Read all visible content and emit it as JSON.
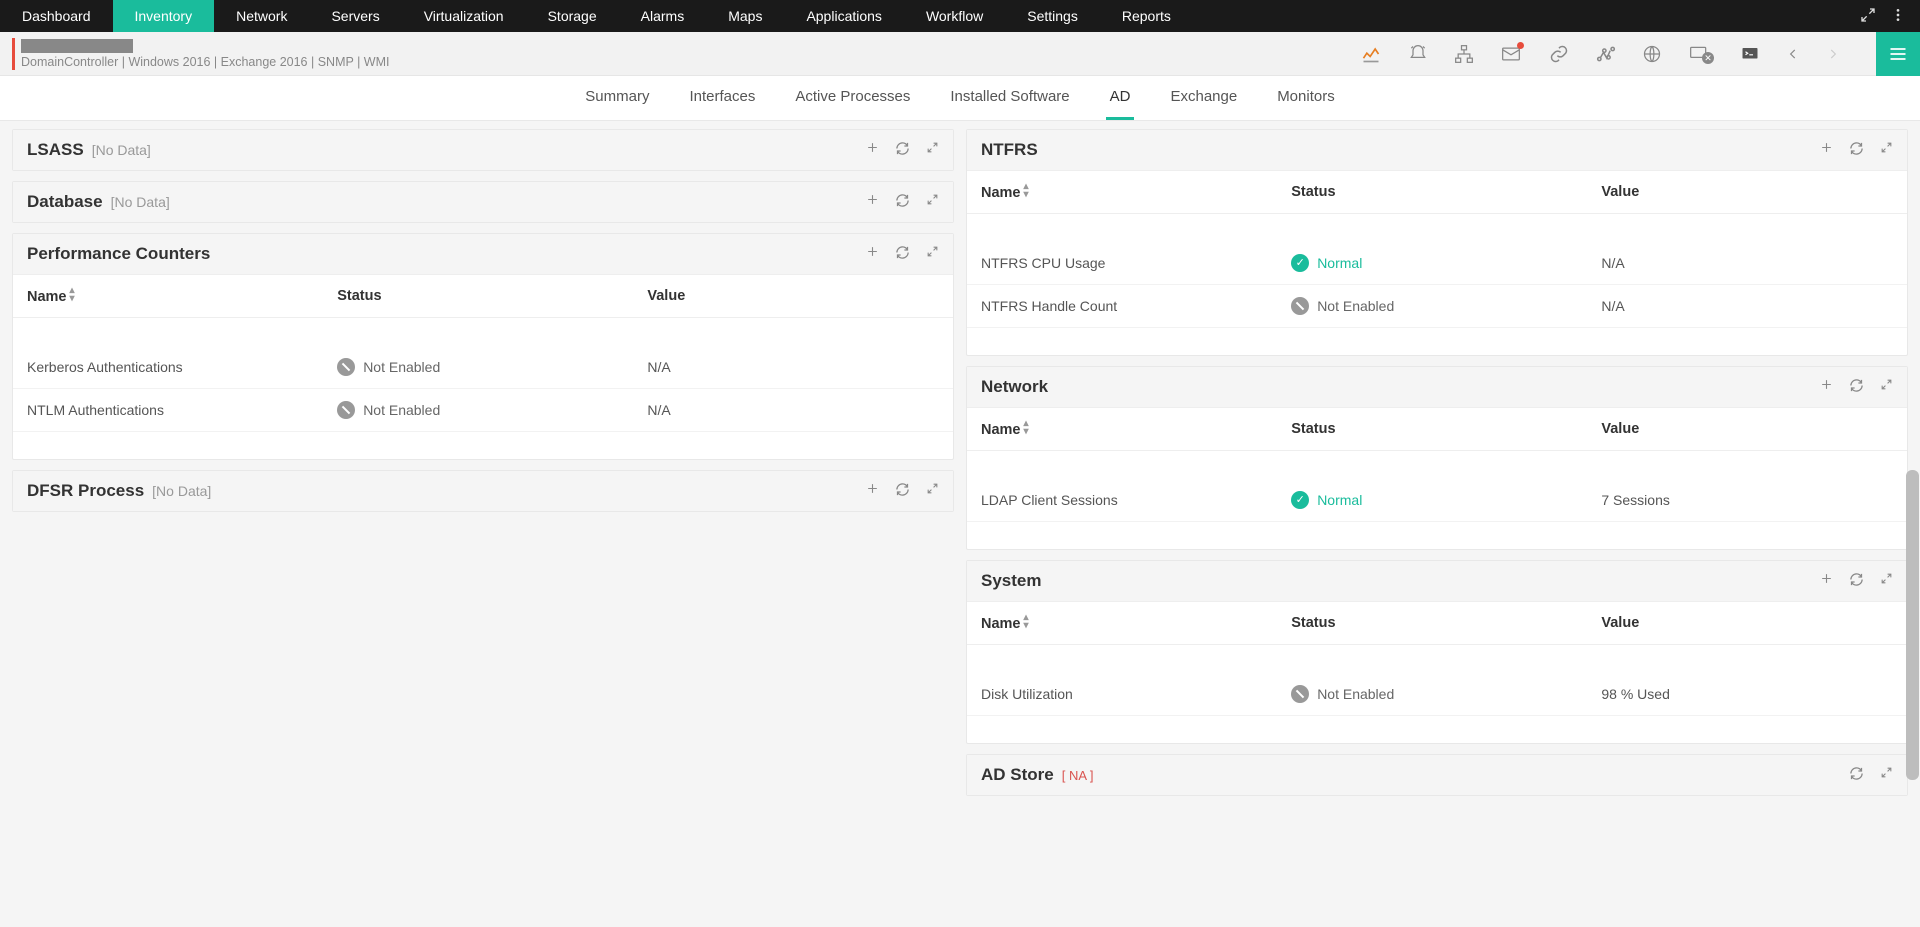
{
  "top_nav": {
    "items": [
      "Dashboard",
      "Inventory",
      "Network",
      "Servers",
      "Virtualization",
      "Storage",
      "Alarms",
      "Maps",
      "Applications",
      "Workflow",
      "Settings",
      "Reports"
    ],
    "active": 1
  },
  "sec_header": {
    "subtitle": "DomainController  |  Windows 2016   |  Exchange 2016   |  SNMP   |  WMI"
  },
  "tabs": {
    "items": [
      "Summary",
      "Interfaces",
      "Active Processes",
      "Installed Software",
      "AD",
      "Exchange",
      "Monitors"
    ],
    "active": 4
  },
  "headers": {
    "name": "Name",
    "status": "Status",
    "value": "Value"
  },
  "status_labels": {
    "normal": "Normal",
    "not_enabled": "Not Enabled"
  },
  "left_panels": [
    {
      "title": "LSASS",
      "tag": "[No Data]",
      "rows": null,
      "actions": [
        "add",
        "refresh",
        "expand"
      ]
    },
    {
      "title": "Database",
      "tag": "[No Data]",
      "rows": null,
      "actions": [
        "add",
        "refresh",
        "expand"
      ]
    },
    {
      "title": "Performance Counters",
      "tag": null,
      "actions": [
        "add",
        "refresh",
        "expand"
      ],
      "rows": [
        {
          "name": "Kerberos Authentications",
          "status": "not_enabled",
          "value": "N/A"
        },
        {
          "name": "NTLM Authentications",
          "status": "not_enabled",
          "value": "N/A"
        }
      ]
    },
    {
      "title": "DFSR Process",
      "tag": "[No Data]",
      "rows": null,
      "actions": [
        "add",
        "refresh",
        "expand"
      ]
    }
  ],
  "right_panels": [
    {
      "title": "NTFRS",
      "tag": null,
      "actions": [
        "add",
        "refresh",
        "expand"
      ],
      "rows": [
        {
          "name": "NTFRS CPU Usage",
          "status": "normal",
          "value": "N/A"
        },
        {
          "name": "NTFRS Handle Count",
          "status": "not_enabled",
          "value": "N/A"
        }
      ]
    },
    {
      "title": "Network",
      "tag": null,
      "actions": [
        "add",
        "refresh",
        "expand"
      ],
      "rows": [
        {
          "name": "LDAP Client Sessions",
          "status": "normal",
          "value": "7 Sessions"
        }
      ]
    },
    {
      "title": "System",
      "tag": null,
      "actions": [
        "add",
        "refresh",
        "expand"
      ],
      "rows": [
        {
          "name": "Disk Utilization",
          "status": "not_enabled",
          "value": "98 % Used"
        }
      ]
    },
    {
      "title": "AD Store",
      "tag": "[ NA ]",
      "tag_class": "na",
      "rows": null,
      "actions": [
        "refresh",
        "expand"
      ]
    }
  ]
}
